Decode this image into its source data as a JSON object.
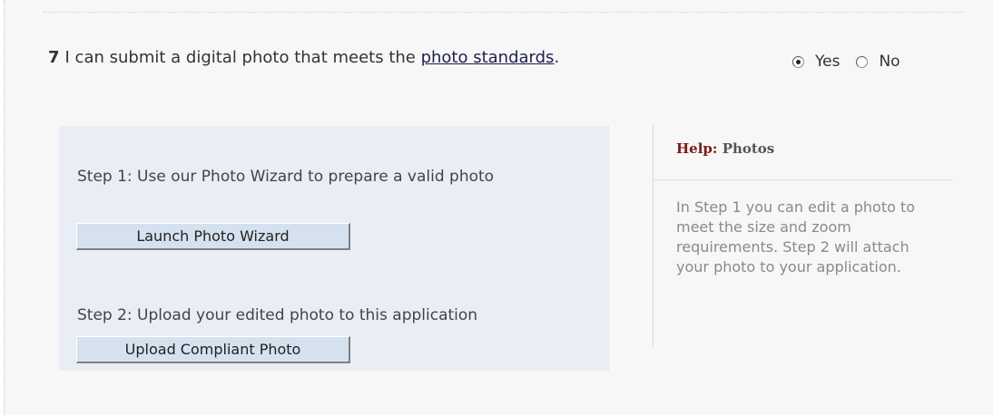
{
  "question": {
    "number": "7",
    "text_before": "I can submit a digital photo that meets the ",
    "link_text": "photo standards",
    "text_after": ".",
    "options": [
      {
        "label": "Yes",
        "checked": true
      },
      {
        "label": "No",
        "checked": false
      }
    ]
  },
  "steps": {
    "step1_text": "Step 1: Use our Photo Wizard to prepare a valid photo",
    "step1_button": "Launch Photo Wizard",
    "step2_text": "Step 2: Upload your edited photo to this application",
    "step2_button": "Upload Compliant Photo"
  },
  "help": {
    "accent": "Help:",
    "topic": "Photos",
    "body": "In Step 1 you can edit a photo to meet the size and zoom requirements. Step 2 will attach your photo to your application."
  }
}
